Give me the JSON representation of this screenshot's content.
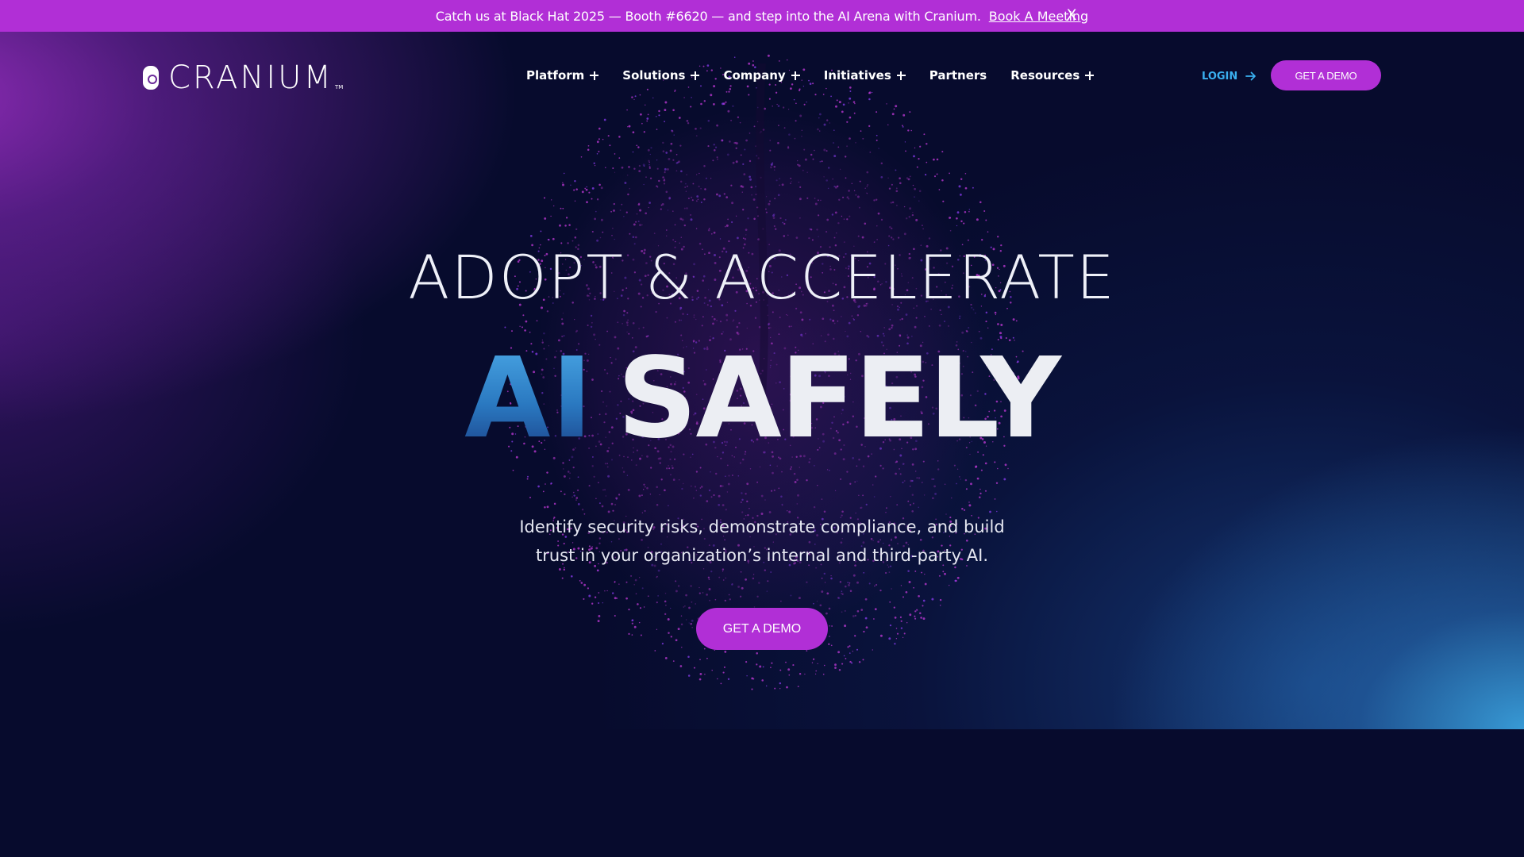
{
  "announcement": {
    "text": "Catch us at Black Hat 2025 — Booth #6620 — and step into the AI Arena with Cranium.",
    "link_label": "Book A Meeting",
    "close_label": "X"
  },
  "brand": {
    "name": "CRANIUM",
    "trademark": "TM"
  },
  "nav": {
    "items": [
      {
        "label": "Platform",
        "has_submenu": true
      },
      {
        "label": "Solutions",
        "has_submenu": true
      },
      {
        "label": "Company",
        "has_submenu": true
      },
      {
        "label": "Initiatives",
        "has_submenu": true
      },
      {
        "label": "Partners",
        "has_submenu": false
      },
      {
        "label": "Resources",
        "has_submenu": true
      }
    ],
    "login_label": "LOGIN",
    "demo_label": "GET A DEMO"
  },
  "hero": {
    "headline_line1": "ADOPT & ACCELERATE",
    "headline_ai": "AI",
    "headline_safely": "SAFELY",
    "subtitle_line1": "Identify security risks, demonstrate compliance, and build",
    "subtitle_line2": "trust in your organization’s internal and third-party AI.",
    "cta_label": "GET A DEMO"
  },
  "colors": {
    "accent_purple": "#b12fd6",
    "login_blue": "#3ab0f0",
    "background_navy": "#070b2d",
    "gradient_blue": "#3aa0dc"
  },
  "icons": {
    "nav_submenu": "plus-icon",
    "login": "arrow-right-icon",
    "announcement_close": "close-icon"
  }
}
